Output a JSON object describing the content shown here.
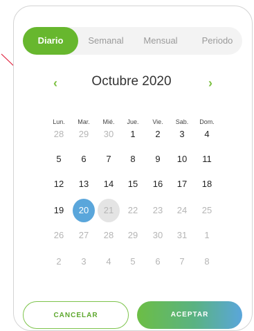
{
  "tabs": [
    {
      "label": "Diario",
      "active": true
    },
    {
      "label": "Semanal",
      "active": false
    },
    {
      "label": "Mensual",
      "active": false
    },
    {
      "label": "Periodo",
      "active": false
    }
  ],
  "calendar": {
    "month_title": "Octubre  2020",
    "prev_icon": "chevron-left-icon",
    "next_icon": "chevron-right-icon",
    "weekdays": [
      "Lun.",
      "Mar.",
      "Mié.",
      "Jue.",
      "Vie.",
      "Sab.",
      "Dom."
    ],
    "weeks": [
      [
        "28",
        "29",
        "30",
        "1",
        "2",
        "3",
        "4"
      ],
      [
        "5",
        "6",
        "7",
        "8",
        "9",
        "10",
        "11"
      ],
      [
        "12",
        "13",
        "14",
        "15",
        "16",
        "17",
        "18"
      ],
      [
        "19",
        "20",
        "21",
        "22",
        "23",
        "24",
        "25"
      ],
      [
        "26",
        "27",
        "28",
        "29",
        "30",
        "31",
        "1"
      ],
      [
        "2",
        "3",
        "4",
        "5",
        "6",
        "7",
        "8"
      ]
    ],
    "selected_day": "20",
    "highlighted_day": "21"
  },
  "buttons": {
    "cancel_label": "CANCELAR",
    "accept_label": "ACEPTAR"
  },
  "colors": {
    "accent_green": "#67b72e",
    "accent_blue": "#5aa6db",
    "pointer_red": "#e0203c"
  }
}
